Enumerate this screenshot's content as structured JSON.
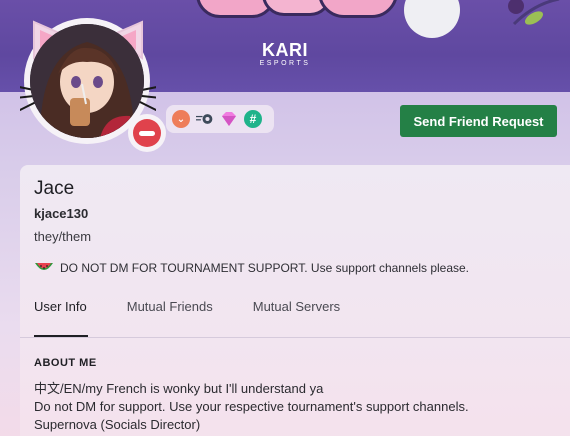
{
  "banner": {
    "brand_name": "KARI",
    "brand_sub": "ESPORTS"
  },
  "profile": {
    "display_name": "Jace",
    "username": "kjace130",
    "pronouns": "they/them",
    "custom_status": "DO NOT DM FOR TOURNAMENT SUPPORT. Use support channels please.",
    "status": "do-not-disturb"
  },
  "badges": [
    "nitro-icon",
    "boost-icon",
    "gem-icon",
    "hashtag-icon"
  ],
  "actions": {
    "send_friend_request": "Send Friend Request"
  },
  "tabs": [
    {
      "label": "User Info",
      "active": true
    },
    {
      "label": "Mutual Friends",
      "active": false
    },
    {
      "label": "Mutual Servers",
      "active": false
    }
  ],
  "about": {
    "heading": "ABOUT ME",
    "lines": [
      "中文/EN/my French is wonky but I'll understand ya",
      "Do not DM for support. Use your respective tournament's support channels.",
      "Supernova (Socials Director)"
    ]
  },
  "colors": {
    "accent_green": "#248046",
    "dnd_red": "#e0424c",
    "banner_purple": "#5f48a0"
  }
}
